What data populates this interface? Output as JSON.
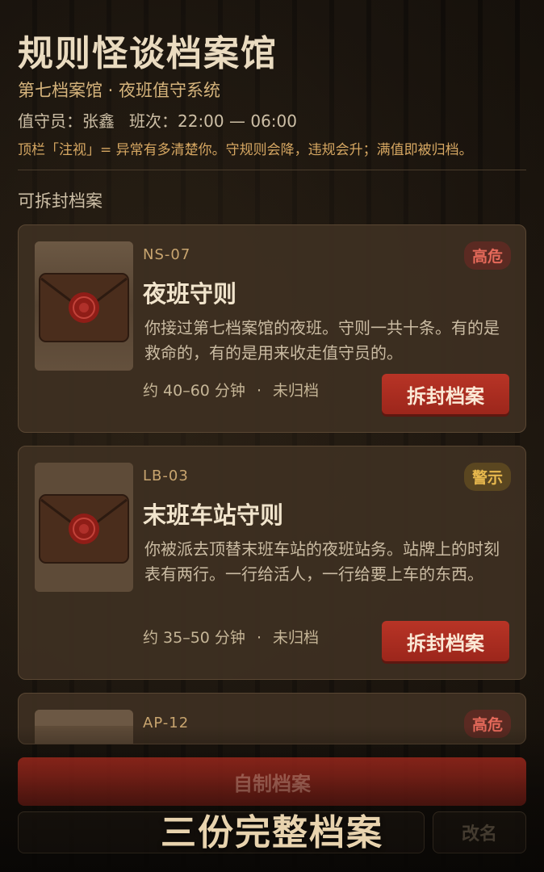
{
  "header": {
    "title": "规则怪谈档案馆",
    "subtitle": "第七档案馆 · 夜班值守系统",
    "guard_label": "值守员：张鑫",
    "shift_label": "班次：22:00 — 06:00",
    "hint": "顶栏「注视」= 异常有多清楚你。守规则会降，违规会升；满值即被归档。"
  },
  "section_label": "可拆封档案",
  "cards": [
    {
      "code": "NS-07",
      "badge": "高危",
      "title": "夜班守则",
      "description": "你接过第七档案馆的夜班。守则一共十条。有的是救命的，有的是用来收走值守员的。",
      "duration": "约 40–60 分钟",
      "status": "未归档",
      "button": "拆封档案"
    },
    {
      "code": "LB-03",
      "badge": "警示",
      "title": "末班车站守则",
      "description": "你被派去顶替末班车站的夜班站务。站牌上的时刻表有两行。一行给活人，一行给要上车的东西。",
      "duration": "约 35–50 分钟",
      "status": "未归档",
      "button": "拆封档案"
    },
    {
      "code": "AP-12",
      "badge": "高危"
    }
  ],
  "footer": {
    "custom_button": "自制档案",
    "rename_button": "改名",
    "banner": "三份完整档案"
  },
  "colors": {
    "accent_red": "#b83426",
    "danger_badge": "#e5695a",
    "warn_badge": "#e7b84d",
    "gold_text": "#d6b47c"
  },
  "icons": {
    "thumbnail": "wax-sealed-envelope-icon",
    "separator": "dot"
  }
}
